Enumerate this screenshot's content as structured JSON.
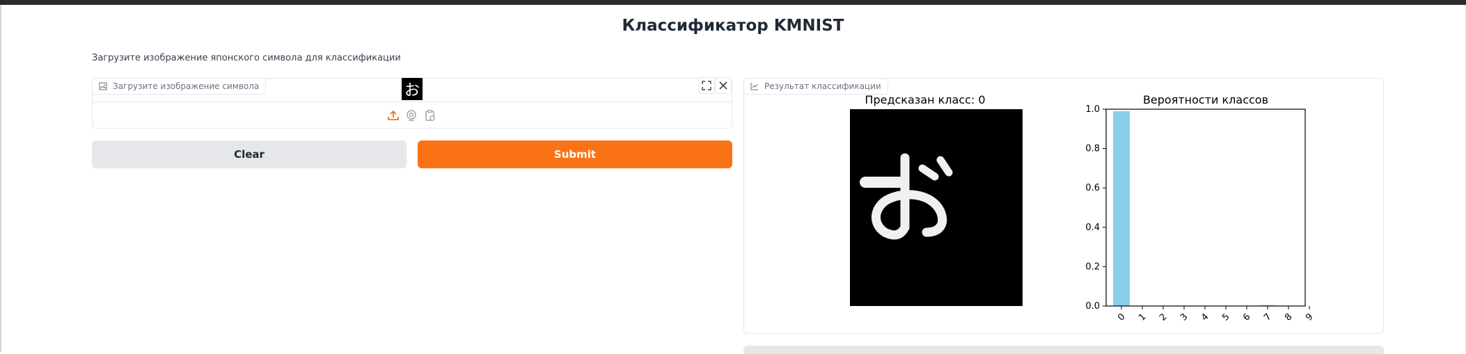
{
  "header": {
    "title": "Классификатор KMNIST",
    "description": "Загрузите изображение японского символа для классификации"
  },
  "input_panel": {
    "label": "Загрузите изображение символа",
    "preview_glyph": "お",
    "sources": [
      "upload-icon",
      "webcam-icon",
      "clipboard-icon"
    ],
    "actions": [
      "fullscreen-icon",
      "close-icon"
    ]
  },
  "buttons": {
    "clear": "Clear",
    "submit": "Submit"
  },
  "output_panel": {
    "label": "Результат классификации",
    "image_title": "Предсказан класс: 0"
  },
  "colors": {
    "accent": "#f97316",
    "bar": "#87ceeb"
  },
  "chart_data": {
    "type": "bar",
    "title": "Вероятности классов",
    "categories": [
      "0",
      "1",
      "2",
      "3",
      "4",
      "5",
      "6",
      "7",
      "8",
      "9"
    ],
    "values": [
      0.99,
      0.0,
      0.0,
      0.0,
      0.0,
      0.0,
      0.0,
      0.005,
      0.0,
      0.0
    ],
    "ylim": [
      0,
      1.0
    ],
    "yticks": [
      "0.0",
      "0.2",
      "0.4",
      "0.6",
      "0.8",
      "1.0"
    ],
    "xlabel": "",
    "ylabel": "",
    "grid": false
  }
}
